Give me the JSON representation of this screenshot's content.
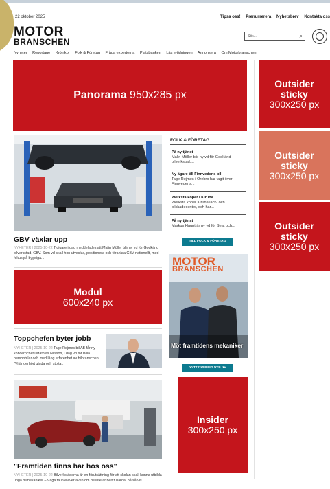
{
  "header": {
    "date": "22 oktober 2025",
    "top_links": [
      "Tipsa oss!",
      "Prenumerera",
      "Nyhetsbrev",
      "Kontakta oss"
    ],
    "logo_line1": "MOTOR",
    "logo_line2": "BRANSCHEN",
    "search_placeholder": "Sök..."
  },
  "nav": [
    "Nyheter",
    "Reportage",
    "Krönikor",
    "Folk & Företag",
    "Fråga experterna",
    "Platsbanken",
    "Läs e-tidningen",
    "Annonsera",
    "Om Motorbranschen"
  ],
  "ads": {
    "panorama_title": "Panorama",
    "panorama_size": "950x285 px",
    "outsider_line1": "Outsider",
    "outsider_line2": "sticky",
    "outsider_size": "300x250 px",
    "modul_title": "Modul",
    "modul_size": "600x240 px",
    "insider_title": "Insider",
    "insider_size": "300x250 px"
  },
  "articles": [
    {
      "title": "GBV växlar upp",
      "meta": "NYHETER | 2025-10-22",
      "text": "Tidigare i dag meddelades att Malin Möller blir ny vd för Godkänd bilverkstad, GBV. Som vd skall hon utveckla, positionera och förankra GBV nationellt, med fokus på bygdiga..."
    },
    {
      "title": "Toppchefen byter jobb",
      "meta": "NYHETER | 2025-10-22",
      "text": "Tage Rejmes bil AB får ny koncernchef i Mathias Nilsson, i dag vd för Bilia personbilar och med lång erfarenhet av bilbranschen. \"Vi är oerhört glada och stolta..."
    },
    {
      "title": "\"Framtiden finns här hos oss\"",
      "meta": "NYHETER | 2025-10-22",
      "text": "Bilverkstäderna är en förutsättning för att skolan skall kunna utbilda unga bilmekaniker – Väga ta in elever även om de inte är helt fullärda, på så vis..."
    }
  ],
  "folk_foretag": {
    "title": "FOLK & FÖRETAG",
    "items": [
      {
        "head": "På ny tjänst",
        "text": "Malin Möller blir ny vd för Godkänd bilverkstad,..."
      },
      {
        "head": "Ny ägare till Finnvedens bil",
        "text": "Tage Rejmes i Örebro har tagit över Finnvedens..."
      },
      {
        "head": "Werksta köper i Kiruna",
        "text": "Werksta köper Kiruna lack- och bilskadecenter, och har..."
      },
      {
        "head": "På ny tjänst",
        "text": "Markus Haupt är ny vd för Seat och..."
      }
    ],
    "button": "TILL FOLK & FÖRETAG"
  },
  "magazine": {
    "logo_line1": "MOTOR",
    "logo_line2": "BRANSCHEN",
    "headline": "Möt framtidens mekaniker",
    "button": "NYTT NUMMER UTE NU"
  },
  "colors": {
    "ad_red": "#c4151c",
    "ad_salmon": "#d9745c",
    "button_teal": "#0c7a8f"
  }
}
